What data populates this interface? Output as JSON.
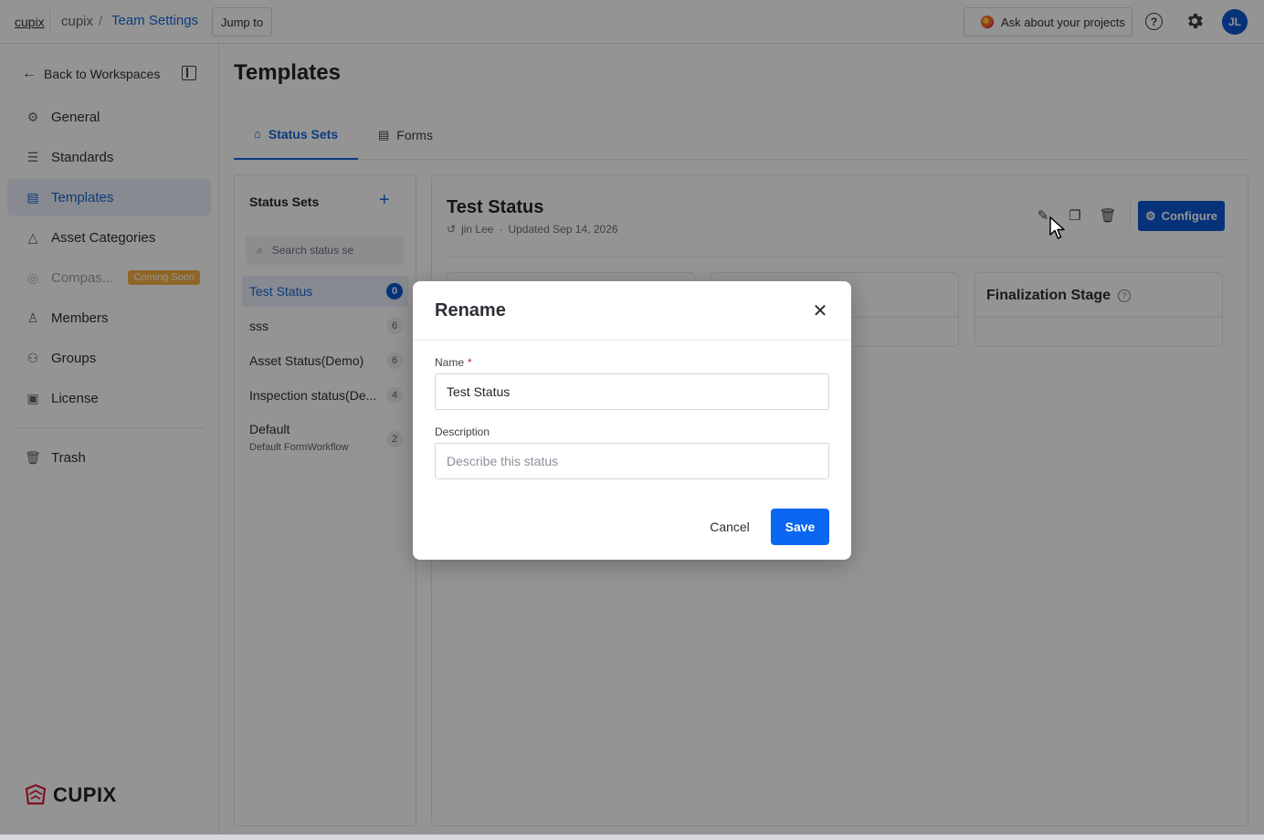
{
  "topbar": {
    "brand": "cupix",
    "org": "cupix",
    "separator": "/",
    "current_page": "Team Settings",
    "jump_to": "Jump to",
    "ask": "Ask about your projects",
    "avatar_initials": "JL"
  },
  "sidebar": {
    "back": "Back to Workspaces",
    "items": [
      {
        "label": "General",
        "icon": "gear-icon"
      },
      {
        "label": "Standards",
        "icon": "sliders-icon"
      },
      {
        "label": "Templates",
        "icon": "document-icon"
      },
      {
        "label": "Asset Categories",
        "icon": "shapes-icon"
      },
      {
        "label": "Compas...",
        "icon": "compass-icon",
        "badge": "Coming Soon"
      },
      {
        "label": "Members",
        "icon": "person-icon"
      },
      {
        "label": "Groups",
        "icon": "group-icon"
      },
      {
        "label": "License",
        "icon": "license-icon"
      },
      {
        "label": "Trash",
        "icon": "trash-icon"
      }
    ],
    "logo": "CUPIX"
  },
  "main": {
    "title": "Templates",
    "tabs": [
      {
        "label": "Status Sets",
        "active": true
      },
      {
        "label": "Forms",
        "active": false
      }
    ],
    "status_sets": {
      "title": "Status Sets",
      "search_placeholder": "Search status se",
      "items": [
        {
          "label": "Test Status",
          "count": "0",
          "active": true
        },
        {
          "label": "sss",
          "count": "6"
        },
        {
          "label": "Asset Status(Demo)",
          "count": "6"
        },
        {
          "label": "Inspection status(De...",
          "count": "4"
        },
        {
          "label": "Default",
          "count": "2",
          "subtitle": "Default FormWorkflow"
        }
      ]
    },
    "detail": {
      "title": "Test Status",
      "author": "jin Lee",
      "dot": "·",
      "updated": "Updated Sep 14, 2026",
      "configure": "Configure",
      "stage_finalization": "Finalization Stage"
    }
  },
  "dialog": {
    "title": "Rename",
    "name_label": "Name",
    "required_mark": "*",
    "name_value": "Test Status",
    "description_label": "Description",
    "description_placeholder": "Describe this status",
    "cancel": "Cancel",
    "save": "Save"
  },
  "colors": {
    "accent": "#1766d8",
    "primary_button": "#0b57d0",
    "save_button": "#0b66f0",
    "overlay": "rgba(0,0,0,0.42)"
  }
}
